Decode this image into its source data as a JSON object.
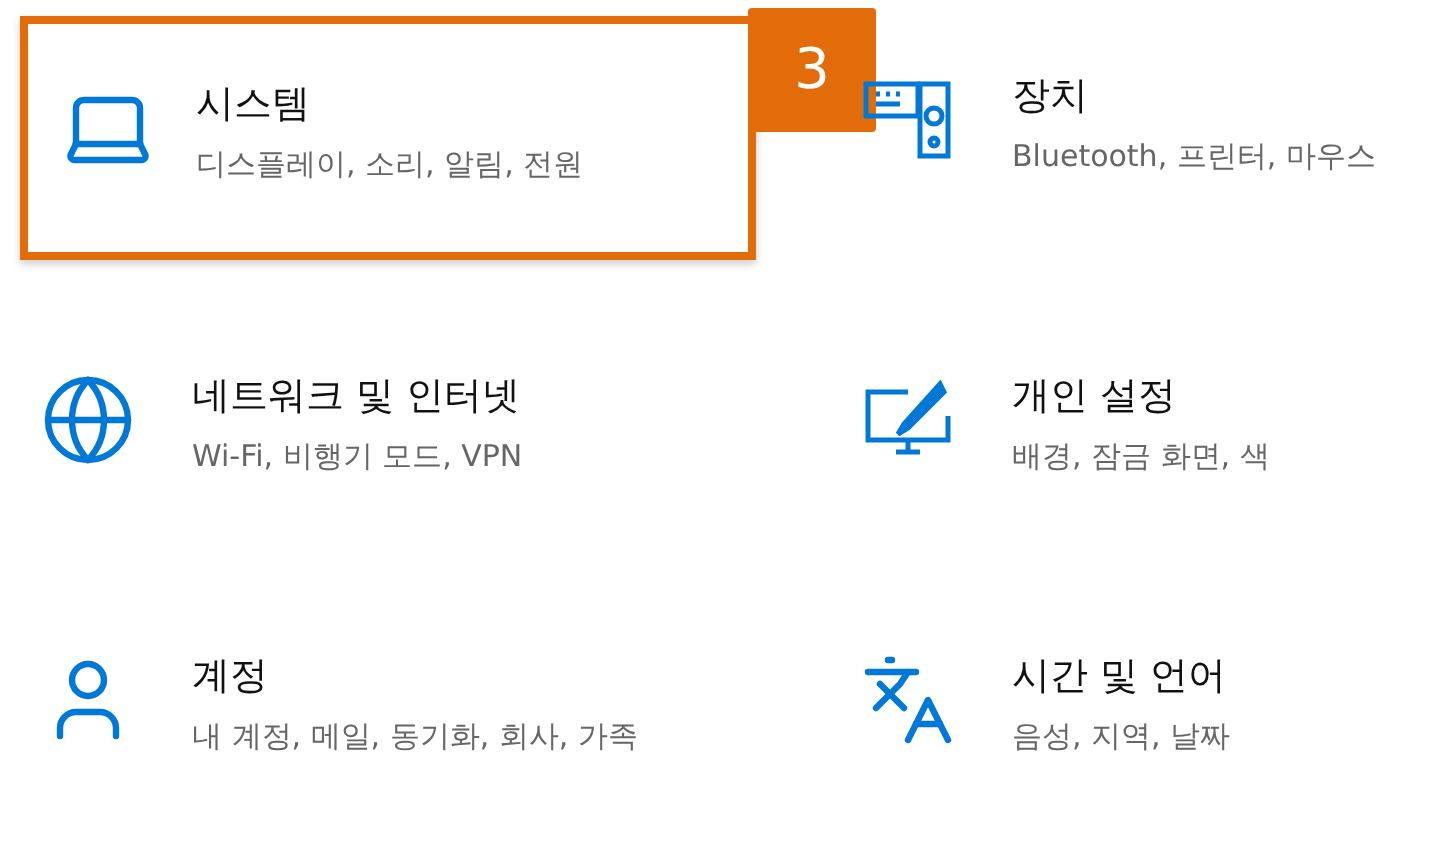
{
  "tiles": [
    {
      "kind": "system",
      "title": "시스템",
      "subtitle": "디스플레이, 소리, 알림, 전원",
      "highlighted": true,
      "badge": "3"
    },
    {
      "kind": "devices",
      "title": "장치",
      "subtitle": "Bluetooth, 프린터, 마우스",
      "highlighted": false
    },
    {
      "kind": "network",
      "title": "네트워크 및 인터넷",
      "subtitle": "Wi-Fi, 비행기 모드, VPN",
      "highlighted": false
    },
    {
      "kind": "personalization",
      "title": "개인 설정",
      "subtitle": "배경, 잠금 화면, 색",
      "highlighted": false
    },
    {
      "kind": "accounts",
      "title": "계정",
      "subtitle": "내 계정, 메일, 동기화, 회사, 가족",
      "highlighted": false
    },
    {
      "kind": "time",
      "title": "시간 및 언어",
      "subtitle": "음성, 지역, 날짜",
      "highlighted": false
    }
  ]
}
